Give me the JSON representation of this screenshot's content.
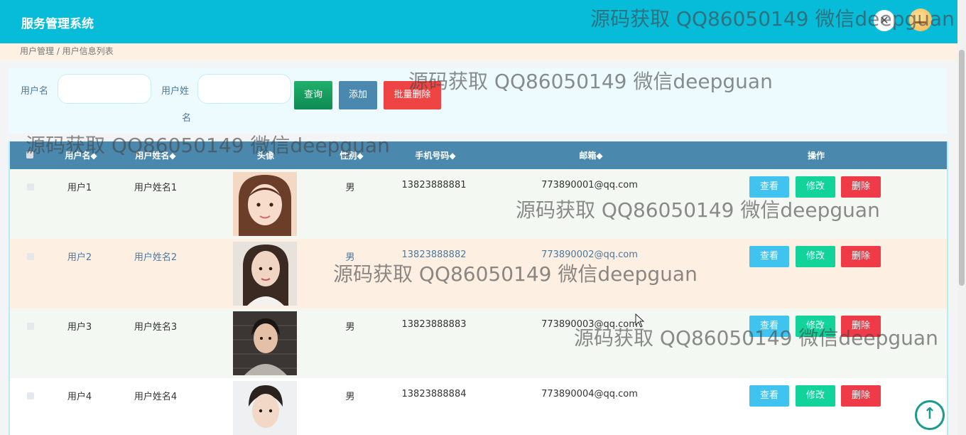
{
  "app": {
    "title": "服务管理系统"
  },
  "header": {
    "close_glyph": "✕"
  },
  "breadcrumb": "用户管理 / 用户信息列表",
  "search": {
    "username_label": "用户名",
    "username_value": "",
    "name_label_line1": "用户姓",
    "name_label_line2": "名",
    "name_value": "",
    "search_button": "查询",
    "add_button": "添加",
    "batch_delete_button": "批量删除"
  },
  "table": {
    "columns": [
      "用户名",
      "用户姓名",
      "头像",
      "性别",
      "手机号码",
      "邮箱",
      "操作"
    ],
    "sort_glyph": "◆",
    "rows": [
      {
        "username": "用户1",
        "name": "用户姓名1",
        "gender": "男",
        "phone": "13823888881",
        "email": "773890001@qq.com"
      },
      {
        "username": "用户2",
        "name": "用户姓名2",
        "gender": "男",
        "phone": "13823888882",
        "email": "773890002@qq.com"
      },
      {
        "username": "用户3",
        "name": "用户姓名3",
        "gender": "男",
        "phone": "13823888883",
        "email": "773890003@qq.com"
      },
      {
        "username": "用户4",
        "name": "用户姓名4",
        "gender": "男",
        "phone": "13823888884",
        "email": "773890004@qq.com"
      }
    ],
    "actions": {
      "view": "查看",
      "edit": "修改",
      "delete": "删除"
    }
  },
  "back_to_top_glyph": "↑",
  "watermark": "源码获取 QQ86050149 微信deepguan",
  "colors": {
    "header": "#06bcd9",
    "table_head": "#4a88ad",
    "row_alt": "#fdf0e2",
    "row_base": "#f3f8f3",
    "view": "#40c4ef",
    "edit": "#12d39a",
    "delete": "#ef3b47"
  }
}
